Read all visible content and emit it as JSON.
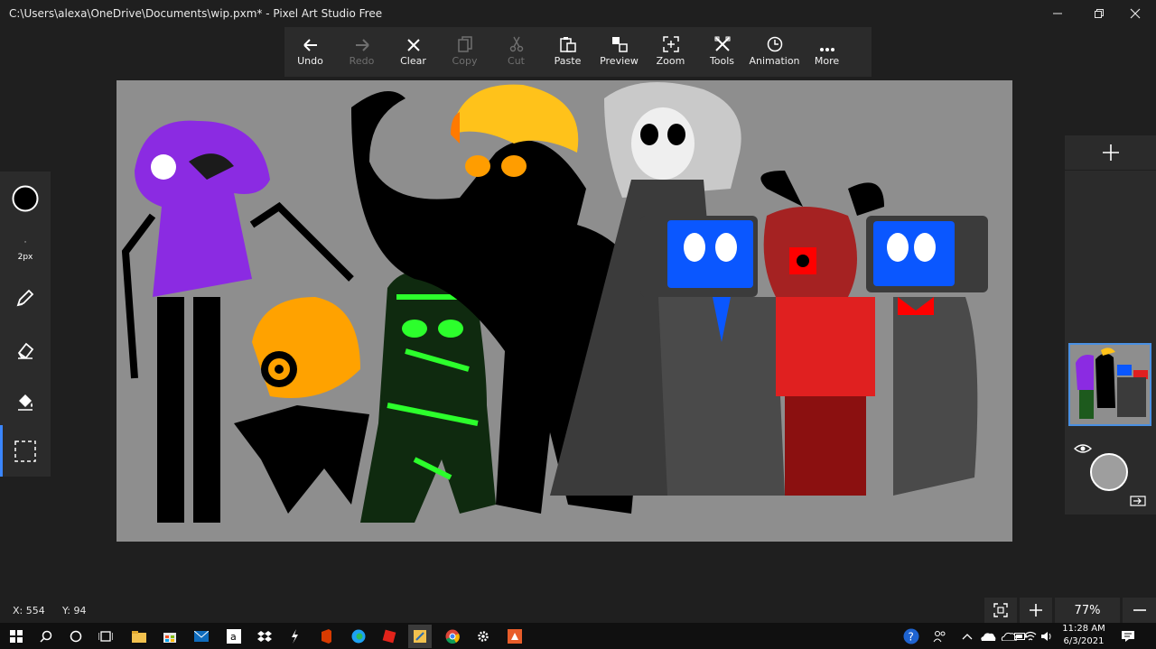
{
  "window": {
    "title": "C:\\Users\\alexa\\OneDrive\\Documents\\wip.pxm* - Pixel Art Studio Free",
    "controls": [
      "minimize-icon",
      "restore-icon",
      "close-icon"
    ]
  },
  "toolbar": {
    "buttons": [
      {
        "label": "Undo",
        "icon": "undo-arrow-icon",
        "enabled": true
      },
      {
        "label": "Redo",
        "icon": "redo-arrow-icon",
        "enabled": false
      },
      {
        "label": "Clear",
        "icon": "clear-x-icon",
        "enabled": true
      },
      {
        "label": "Copy",
        "icon": "copy-icon",
        "enabled": false
      },
      {
        "label": "Cut",
        "icon": "scissors-icon",
        "enabled": false
      },
      {
        "label": "Paste",
        "icon": "paste-clipboard-icon",
        "enabled": true
      },
      {
        "label": "Preview",
        "icon": "preview-icon",
        "enabled": true
      },
      {
        "label": "Zoom",
        "icon": "zoom-fit-icon",
        "enabled": true
      },
      {
        "label": "Tools",
        "icon": "tools-icon",
        "enabled": true
      },
      {
        "label": "Animation",
        "icon": "clock-icon",
        "enabled": true
      },
      {
        "label": "More",
        "icon": "more-dots-icon",
        "enabled": true
      }
    ]
  },
  "left_panel": {
    "brush_size_label": "2px",
    "tools": [
      "brush-color-circle-icon",
      "brush-size-icon",
      "pencil-icon",
      "eraser-icon",
      "paint-bucket-icon",
      "selection-icon"
    ],
    "active_tool": "selection-icon",
    "accent": "#3a86ff"
  },
  "right_panel": {
    "add_layer_icon": "plus-icon",
    "visibility_icon": "eye-icon",
    "color_preview": "#9e9e9e",
    "export_icon": "layer-export-icon"
  },
  "status": {
    "x": "X: 554",
    "y": "Y: 94",
    "zoom": "77%",
    "fit_icon": "fit-screen-icon",
    "zoom_in_icon": "plus-icon",
    "zoom_out_icon": "minus-icon"
  },
  "canvas": {
    "background": "#8e8e8e"
  },
  "taskbar": {
    "time": "11:28 AM",
    "date": "6/3/2021",
    "apps": [
      "windows-start-icon",
      "search-icon",
      "cortana-icon",
      "task-view-icon",
      "file-explorer-icon",
      "store-icon",
      "mail-icon",
      "amazon-icon",
      "dropbox-icon",
      "app-icon",
      "office-icon",
      "edge-icon",
      "roblox-icon",
      "pixel-art-studio-icon",
      "chrome-icon",
      "settings-icon",
      "app-icon"
    ],
    "tray": [
      "help-icon",
      "people-icon",
      "chevron-up-icon",
      "onedrive-icon",
      "onedrive-icon",
      "battery-icon",
      "wifi-icon",
      "volume-icon",
      "notification-icon"
    ]
  }
}
